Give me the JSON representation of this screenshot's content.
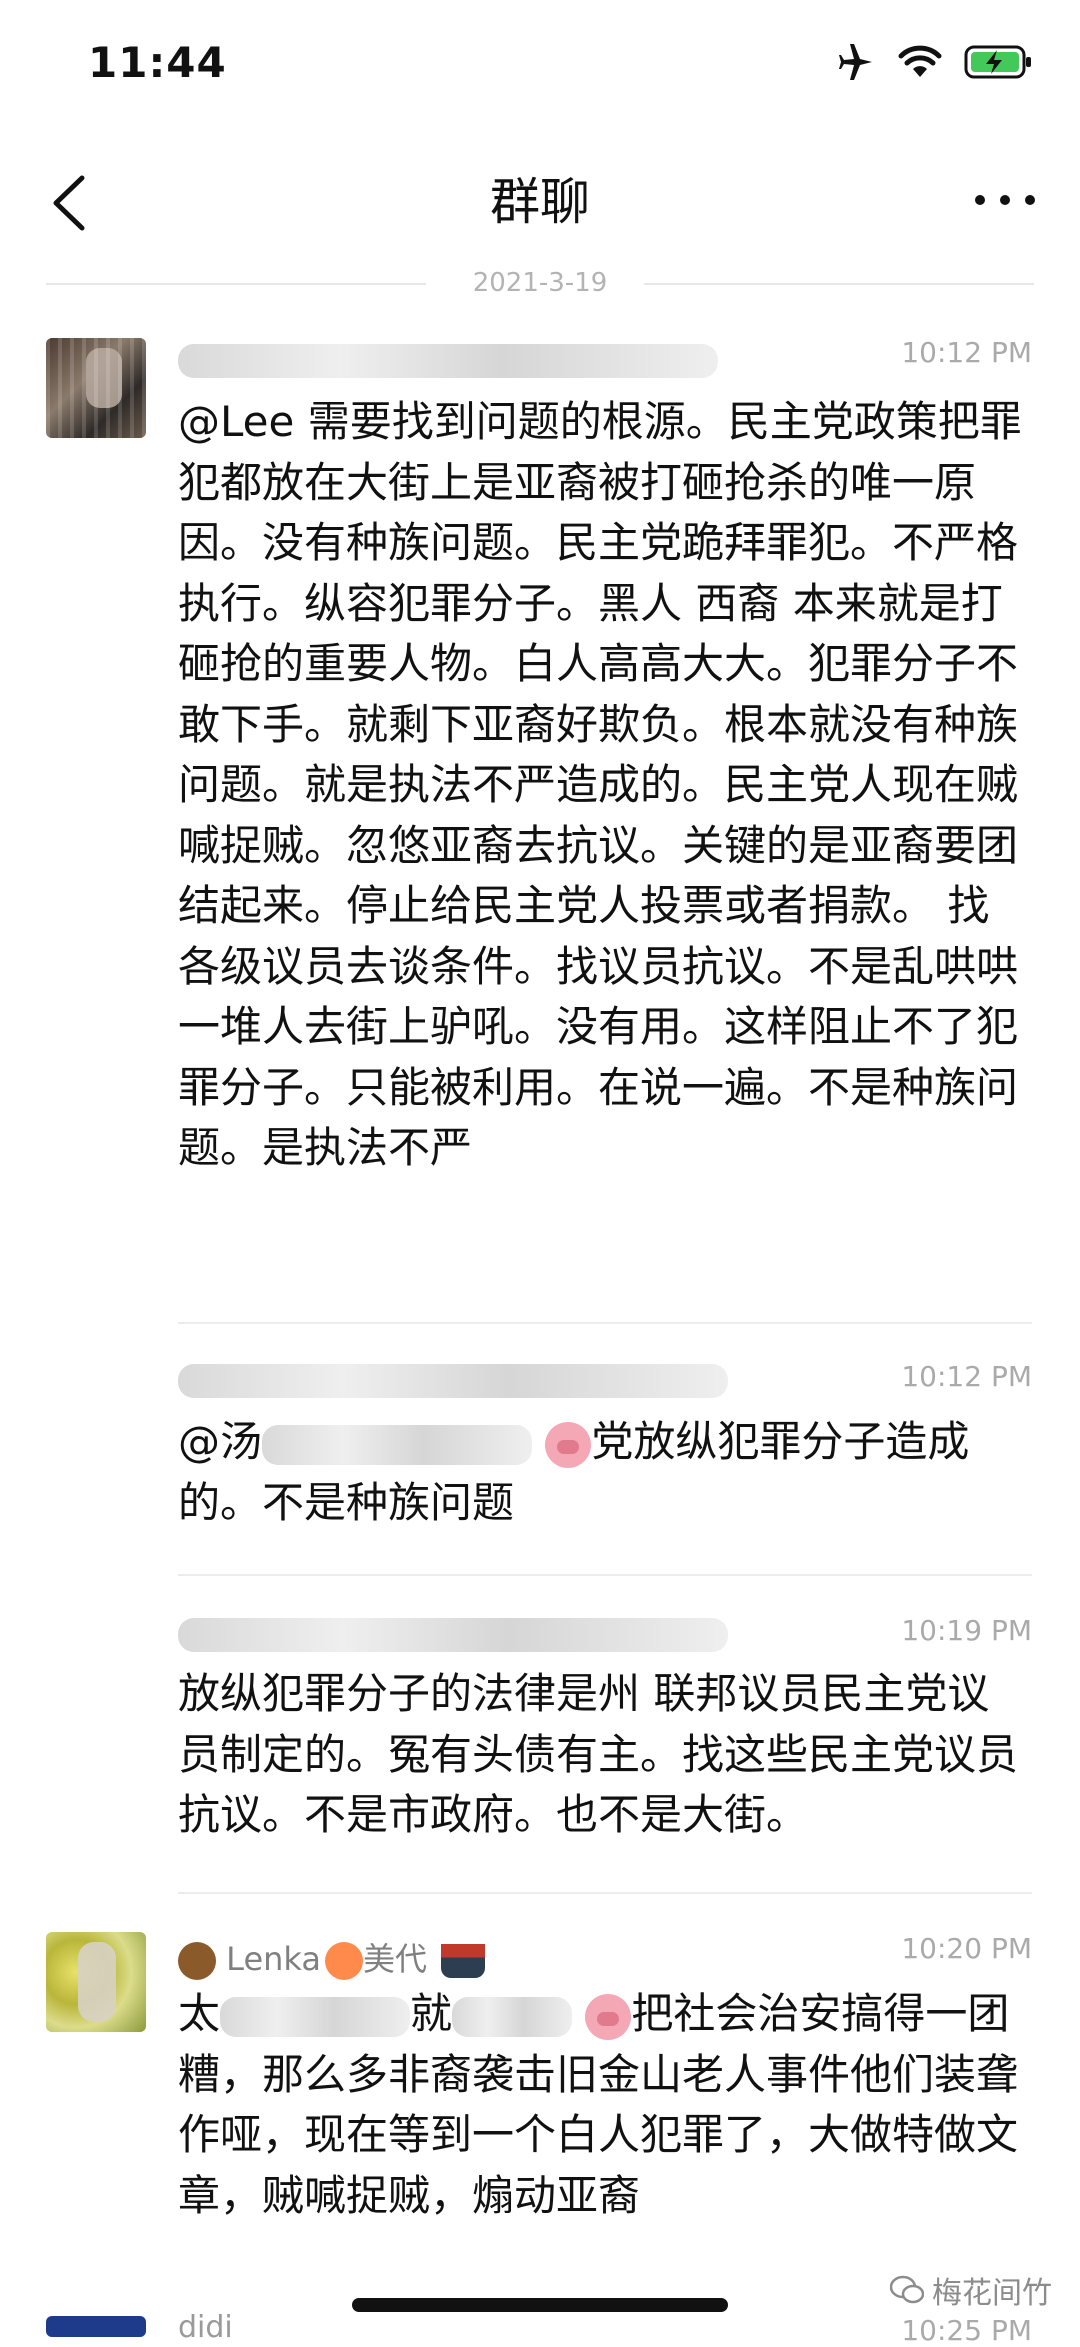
{
  "status_bar": {
    "time": "11:44"
  },
  "nav": {
    "title": "群聊"
  },
  "date_separator": "2021-3-19",
  "messages": [
    {
      "time": "10:12 PM",
      "text": "@Lee 需要找到问题的根源。民主党政策把罪犯都放在大街上是亚裔被打砸抢杀的唯一原因。没有种族问题。民主党跪拜罪犯。不严格执行。纵容犯罪分子。黑人 西裔 本来就是打砸抢的重要人物。白人高高大大。犯罪分子不敢下手。就剩下亚裔好欺负。根本就没有种族问题。就是执法不严造成的。民主党人现在贼喊捉贼。忽悠亚裔去抗议。关键的是亚裔要团结起来。停止给民主党人投票或者捐款。 找各级议员去谈条件。找议员抗议。不是乱哄哄一堆人去街上驴吼。没有用。这样阻止不了犯罪分子。只能被利用。在说一遍。不是种族问题。是执法不严"
    },
    {
      "time": "10:12 PM",
      "text_prefix": "@汤",
      "text_body": "党放纵犯罪分子造成的。不是种族问题"
    },
    {
      "time": "10:19 PM",
      "text": "放纵犯罪分子的法律是州 联邦议员民主党议员制定的。冤有头债有主。找这些民主党议员抗议。不是市政府。也不是大街。"
    },
    {
      "sender": "Lenka",
      "sender_suffix": "美代",
      "time": "10:20 PM",
      "text_line1_start": "太",
      "text_line1_mid": "就",
      "text_line1_end": "把社会治安搞得",
      "text_rest": "一团糟，那么多非裔袭击旧金山老人事件他们装聋作哑，现在等到一个白人犯罪了，大做特做文章，贼喊捉贼，煽动亚裔"
    },
    {
      "sender": "didi",
      "time": "10:25 PM"
    }
  ],
  "watermark": "梅花间竹"
}
